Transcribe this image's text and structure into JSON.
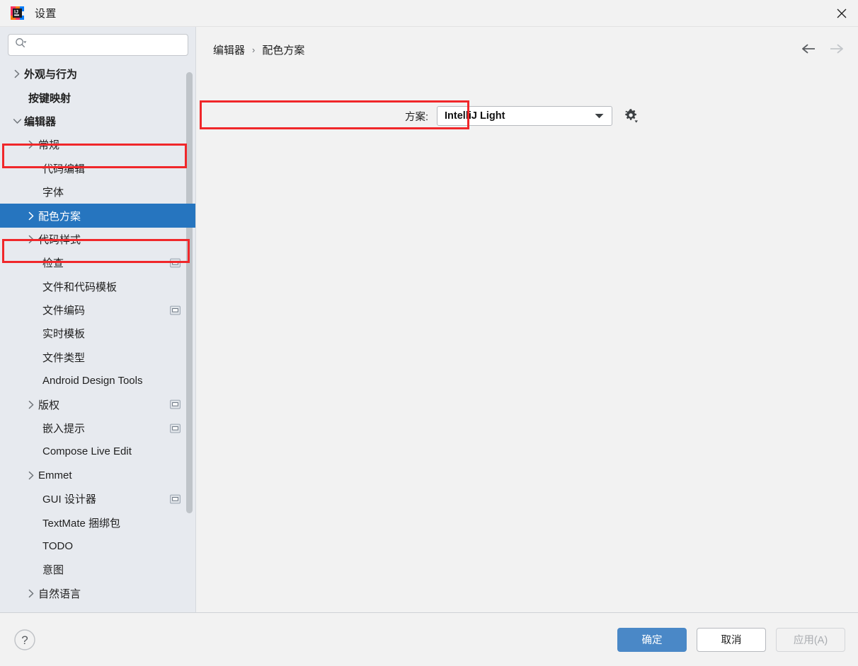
{
  "window": {
    "title": "设置",
    "app_icon": "intellij-idea-icon",
    "close_icon": "close-icon"
  },
  "sidebar": {
    "search": {
      "icon": "search-icon",
      "value": "",
      "placeholder": ""
    },
    "items": [
      {
        "label": "外观与行为",
        "level": 0,
        "arrow": "chevron-right",
        "bold": true,
        "selected": false,
        "badge": false
      },
      {
        "label": "按键映射",
        "level": 0,
        "arrow": "none",
        "bold": true,
        "selected": false,
        "badge": false
      },
      {
        "label": "编辑器",
        "level": 0,
        "arrow": "chevron-down",
        "bold": true,
        "selected": false,
        "badge": false
      },
      {
        "label": "常规",
        "level": 1,
        "arrow": "chevron-right",
        "bold": false,
        "selected": false,
        "badge": false
      },
      {
        "label": "代码编辑",
        "level": 1,
        "arrow": "none",
        "bold": false,
        "selected": false,
        "badge": false
      },
      {
        "label": "字体",
        "level": 1,
        "arrow": "none",
        "bold": false,
        "selected": false,
        "badge": false
      },
      {
        "label": "配色方案",
        "level": 1,
        "arrow": "chevron-right",
        "bold": false,
        "selected": true,
        "badge": false
      },
      {
        "label": "代码样式",
        "level": 1,
        "arrow": "chevron-right",
        "bold": false,
        "selected": false,
        "badge": false
      },
      {
        "label": "检查",
        "level": 1,
        "arrow": "none",
        "bold": false,
        "selected": false,
        "badge": true
      },
      {
        "label": "文件和代码模板",
        "level": 1,
        "arrow": "none",
        "bold": false,
        "selected": false,
        "badge": false
      },
      {
        "label": "文件编码",
        "level": 1,
        "arrow": "none",
        "bold": false,
        "selected": false,
        "badge": true
      },
      {
        "label": "实时模板",
        "level": 1,
        "arrow": "none",
        "bold": false,
        "selected": false,
        "badge": false
      },
      {
        "label": "文件类型",
        "level": 1,
        "arrow": "none",
        "bold": false,
        "selected": false,
        "badge": false
      },
      {
        "label": "Android Design Tools",
        "level": 1,
        "arrow": "none",
        "bold": false,
        "selected": false,
        "badge": false
      },
      {
        "label": "版权",
        "level": 1,
        "arrow": "chevron-right",
        "bold": false,
        "selected": false,
        "badge": true
      },
      {
        "label": "嵌入提示",
        "level": 1,
        "arrow": "none",
        "bold": false,
        "selected": false,
        "badge": true
      },
      {
        "label": "Compose Live Edit",
        "level": 1,
        "arrow": "none",
        "bold": false,
        "selected": false,
        "badge": false
      },
      {
        "label": "Emmet",
        "level": 1,
        "arrow": "chevron-right",
        "bold": false,
        "selected": false,
        "badge": false
      },
      {
        "label": "GUI 设计器",
        "level": 1,
        "arrow": "none",
        "bold": false,
        "selected": false,
        "badge": true
      },
      {
        "label": "TextMate 捆绑包",
        "level": 1,
        "arrow": "none",
        "bold": false,
        "selected": false,
        "badge": false
      },
      {
        "label": "TODO",
        "level": 1,
        "arrow": "none",
        "bold": false,
        "selected": false,
        "badge": false
      },
      {
        "label": "意图",
        "level": 1,
        "arrow": "none",
        "bold": false,
        "selected": false,
        "badge": false
      },
      {
        "label": "自然语言",
        "level": 1,
        "arrow": "chevron-right",
        "bold": false,
        "selected": false,
        "badge": false
      }
    ],
    "scrollbar": {
      "top_pct": 2,
      "height_pct": 80
    }
  },
  "main": {
    "breadcrumb": {
      "parent": "编辑器",
      "separator": "›",
      "current": "配色方案"
    },
    "nav": {
      "back_icon": "arrow-left-icon",
      "forward_icon": "arrow-right-icon",
      "back_enabled": true,
      "forward_enabled": false
    },
    "scheme": {
      "label": "方案:",
      "value": "IntelliJ Light",
      "caret_icon": "chevron-down-icon",
      "gear_icon": "gear-icon"
    }
  },
  "footer": {
    "help_icon": "help-icon",
    "ok_label": "确定",
    "cancel_label": "取消",
    "apply_label": "应用(A)"
  },
  "colors": {
    "accent_selection": "#2675bf",
    "primary_button": "#4a88c7",
    "annotation": "#f0272a",
    "sidebar_bg": "#e7eaef",
    "panel_bg": "#f2f2f2"
  }
}
